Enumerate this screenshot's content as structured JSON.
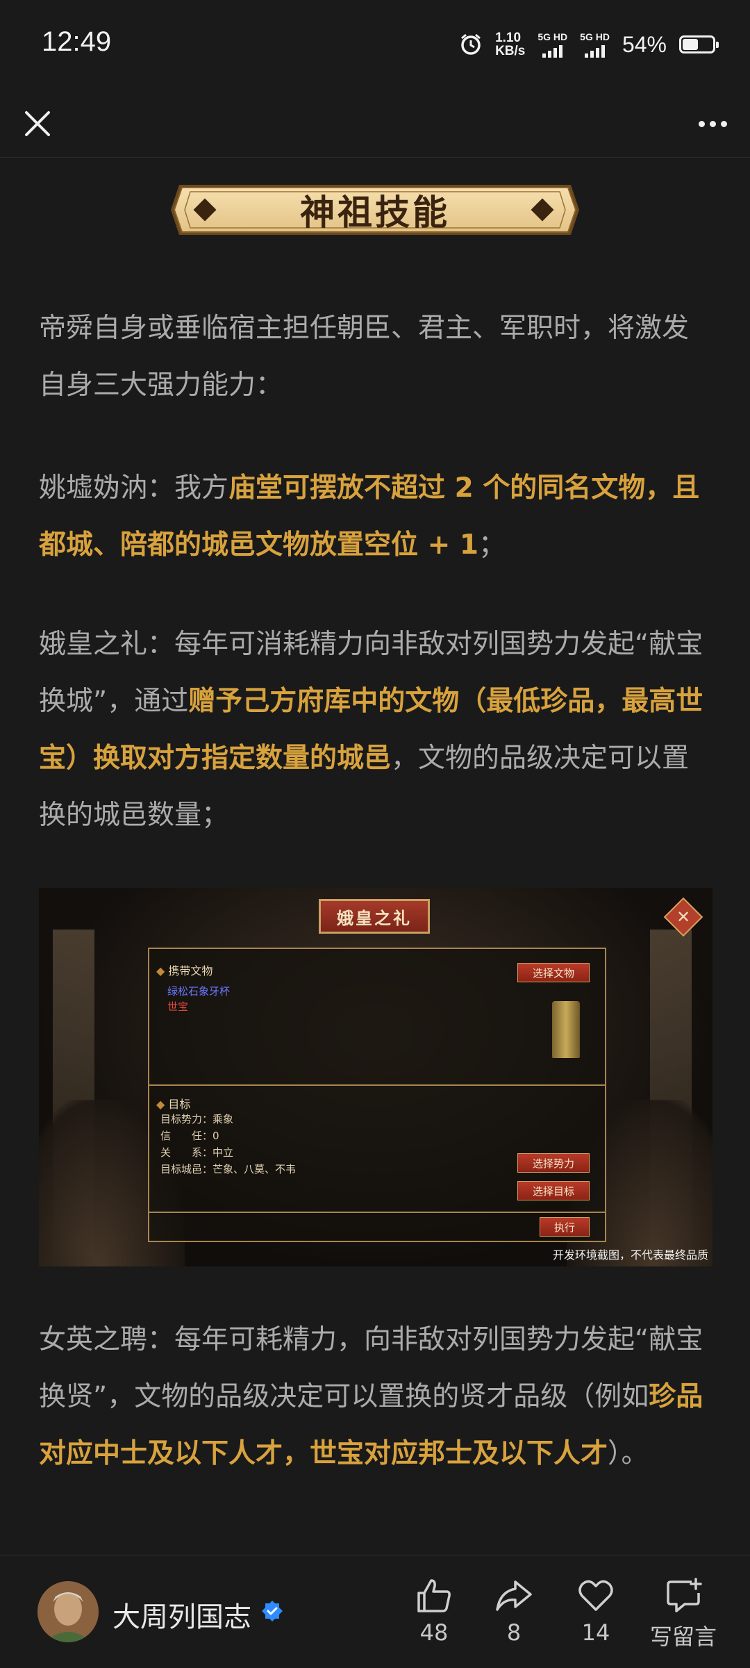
{
  "status_bar": {
    "time": "12:49",
    "net_speed_value": "1.10",
    "net_speed_unit": "KB/s",
    "sim1": "5G HD",
    "sim2": "5G HD",
    "battery": "54%",
    "battery_level": 0.54
  },
  "article": {
    "section_title": "神祖技能",
    "intro": "帝舜自身或垂临宿主担任朝臣、君主、军职时，将激发自身三大强力能力：",
    "skill1": {
      "name": "姚墟妫汭：我方",
      "highlight": "庙堂可摆放不超过 2 个的同名文物，且都城、陪都的城邑文物放置空位 + 1",
      "end": "；"
    },
    "skill2": {
      "name": "娥皇之礼：每年可消耗精力向非敌对列国势力发起“献宝换城”，通过",
      "highlight": "赠予己方府库中的文物（最低珍品，最高世宝）换取对方指定数量的城邑",
      "end": "，文物的品级决定可以置换的城邑数量；"
    },
    "skill3": {
      "name": "女英之聘：每年可耗精力，向非敌对列国势力发起“献宝换贤”，文物的品级决定可以置换的贤才品级（例如",
      "highlight": "珍品对应中士及以下人才，世宝对应邦士及以下人才",
      "end": "）。"
    }
  },
  "game_screenshot": {
    "title": "娥皇之礼",
    "carry_header": "携带文物",
    "artifact_name": "绿松石象牙杯",
    "artifact_grade": "世宝",
    "select_artifact": "选择文物",
    "target_header": "目标",
    "rows": [
      {
        "label": "目标势力：",
        "value": "乘象"
      },
      {
        "label": "信　　任：",
        "value": "0"
      },
      {
        "label": "关　　系：",
        "value": "中立"
      },
      {
        "label": "目标城邑：",
        "value": "芒象、八莫、不韦"
      }
    ],
    "select_force": "选择势力",
    "select_target": "选择目标",
    "execute": "执行",
    "caption": "开发环境截图，不代表最终品质"
  },
  "footer": {
    "author": "大周列国志",
    "likes": "48",
    "shares": "8",
    "favorites": "14",
    "comment_label": "写留言"
  }
}
